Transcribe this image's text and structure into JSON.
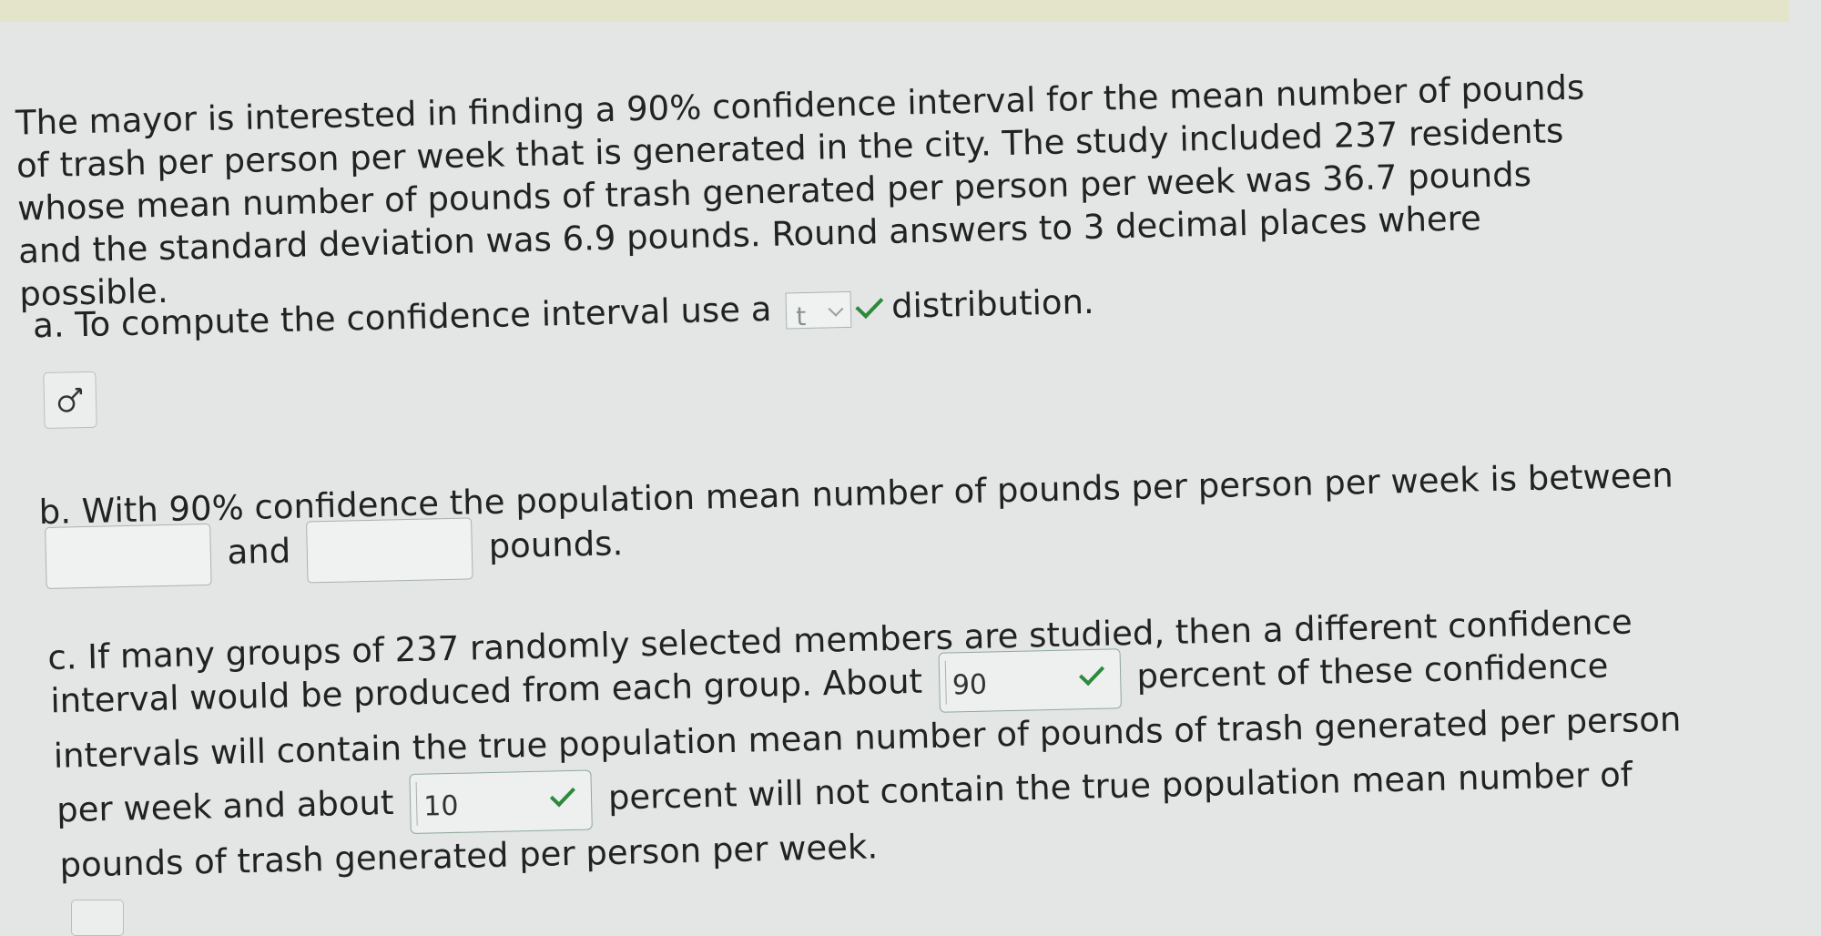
{
  "intro": "The mayor is interested in finding a 90% confidence interval for the mean number of pounds of trash per person per week that is generated in the city. The study included 237 residents whose mean number of pounds of trash generated per person per week was 36.7 pounds and the standard deviation was 6.9 pounds. Round answers to 3 decimal places where possible.",
  "part_a": {
    "before": "a. To compute the confidence interval use a",
    "select_value": "t",
    "after": "distribution."
  },
  "part_b": {
    "line1": "b. With 90% confidence the population mean number of pounds per person per week is between",
    "and": "and",
    "after": "pounds."
  },
  "part_c": {
    "line1": "c. If many groups of 237 randomly selected members are studied, then a different confidence",
    "line2_before": "interval would be produced from each group. About",
    "answer1": "90",
    "line2_after": "percent of these confidence",
    "line3": "intervals will contain the true population mean number of pounds of trash generated per person",
    "line4_before": "per week and about",
    "answer2": "10",
    "line4_after": "percent will not contain the true population mean number of",
    "line5": "pounds of trash generated per person per week."
  },
  "icons": {
    "tool_button": "gender-symbol-icon",
    "check": "check-icon"
  },
  "colors": {
    "correct_check": "#2d8a3c"
  }
}
